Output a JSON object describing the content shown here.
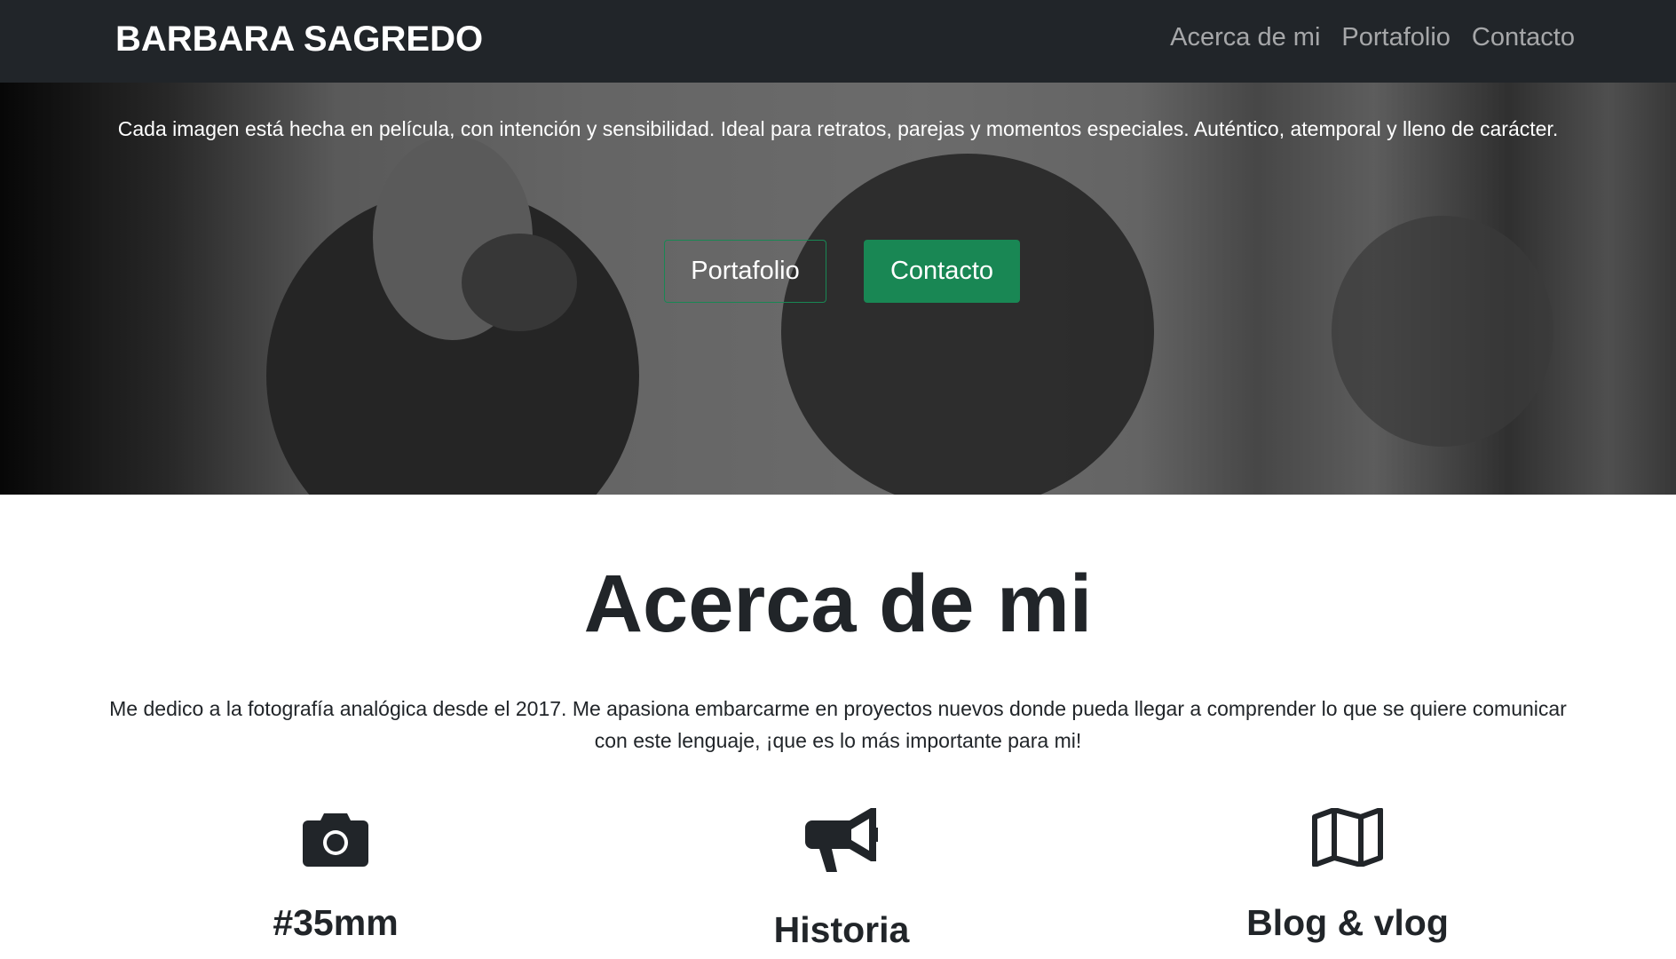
{
  "navbar": {
    "brand": "BARBARA SAGREDO",
    "links": [
      "Acerca de mi",
      "Portafolio",
      "Contacto"
    ]
  },
  "hero": {
    "text": "Cada imagen está hecha en película, con intención y sensibilidad. Ideal para retratos, parejas y momentos especiales. Auténtico, atemporal y lleno de carácter.",
    "buttons": {
      "portfolio": "Portafolio",
      "contact": "Contacto"
    }
  },
  "about": {
    "title": "Acerca de mi",
    "text": "Me dedico a la fotografía analógica desde el 2017. Me apasiona embarcarme en proyectos nuevos donde pueda llegar a comprender lo que se quiere comunicar con este lenguaje, ¡que es lo más importante para mi!",
    "features": [
      {
        "icon": "camera-icon",
        "title": "#35mm"
      },
      {
        "icon": "megaphone-icon",
        "title": "Historia"
      },
      {
        "icon": "map-icon",
        "title": "Blog & vlog"
      }
    ]
  },
  "colors": {
    "navbar": "#212529",
    "accent": "#198754"
  }
}
